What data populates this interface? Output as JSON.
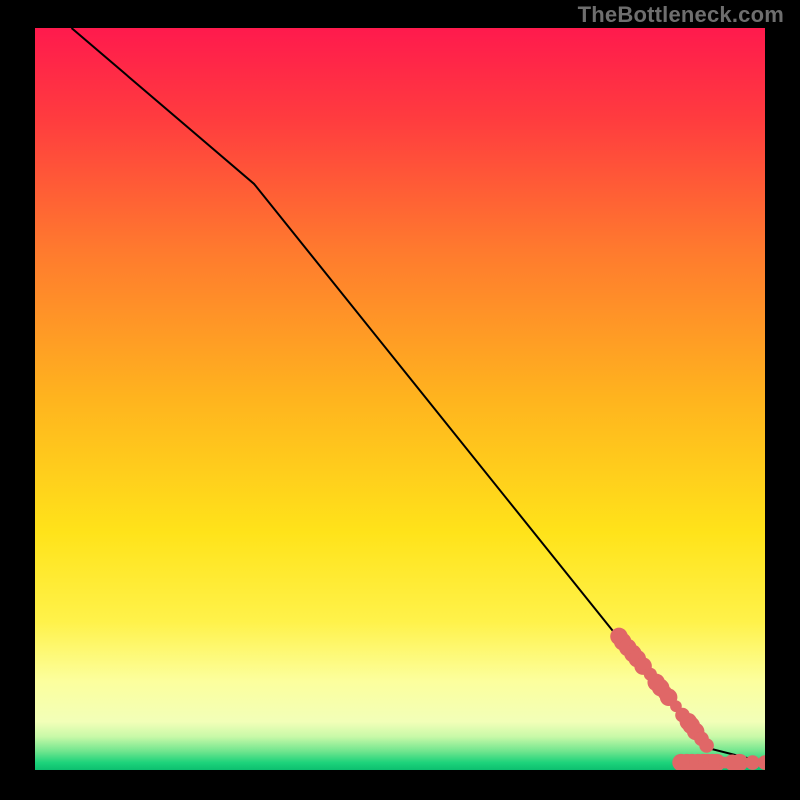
{
  "watermark": "TheBottleneck.com",
  "chart_data": {
    "type": "line",
    "title": "",
    "xlabel": "",
    "ylabel": "",
    "xlim": [
      0,
      100
    ],
    "ylim": [
      0,
      100
    ],
    "line": {
      "x": [
        5,
        30,
        92,
        100
      ],
      "y": [
        100,
        79,
        3,
        1
      ],
      "color": "#000000"
    },
    "scatter": {
      "color": "#e06767",
      "points": [
        {
          "x": 80.0,
          "y": 18.0,
          "r": 1.2
        },
        {
          "x": 80.5,
          "y": 17.3,
          "r": 1.2
        },
        {
          "x": 81.2,
          "y": 16.5,
          "r": 1.2
        },
        {
          "x": 81.9,
          "y": 15.7,
          "r": 1.2
        },
        {
          "x": 82.5,
          "y": 15.0,
          "r": 1.2
        },
        {
          "x": 83.3,
          "y": 14.0,
          "r": 1.2
        },
        {
          "x": 84.3,
          "y": 12.9,
          "r": 0.9
        },
        {
          "x": 85.1,
          "y": 11.8,
          "r": 1.2
        },
        {
          "x": 85.7,
          "y": 11.1,
          "r": 1.2
        },
        {
          "x": 86.3,
          "y": 10.4,
          "r": 1.0
        },
        {
          "x": 86.8,
          "y": 9.8,
          "r": 1.2
        },
        {
          "x": 87.8,
          "y": 8.6,
          "r": 0.8
        },
        {
          "x": 88.7,
          "y": 7.4,
          "r": 1.0
        },
        {
          "x": 89.5,
          "y": 6.5,
          "r": 1.2
        },
        {
          "x": 89.9,
          "y": 6.0,
          "r": 1.2
        },
        {
          "x": 90.5,
          "y": 5.2,
          "r": 1.2
        },
        {
          "x": 91.3,
          "y": 4.2,
          "r": 1.0
        },
        {
          "x": 92.0,
          "y": 3.3,
          "r": 1.0
        },
        {
          "x": 88.5,
          "y": 1.0,
          "r": 1.2
        },
        {
          "x": 89.3,
          "y": 1.0,
          "r": 1.2
        },
        {
          "x": 90.0,
          "y": 1.0,
          "r": 1.2
        },
        {
          "x": 90.8,
          "y": 1.0,
          "r": 1.2
        },
        {
          "x": 91.5,
          "y": 1.0,
          "r": 1.2
        },
        {
          "x": 92.1,
          "y": 1.0,
          "r": 1.2
        },
        {
          "x": 92.8,
          "y": 1.0,
          "r": 1.2
        },
        {
          "x": 93.4,
          "y": 1.0,
          "r": 1.2
        },
        {
          "x": 94.5,
          "y": 1.0,
          "r": 0.8
        },
        {
          "x": 95.5,
          "y": 1.0,
          "r": 1.1
        },
        {
          "x": 96.5,
          "y": 1.0,
          "r": 1.2
        },
        {
          "x": 98.3,
          "y": 1.0,
          "r": 1.0
        },
        {
          "x": 100.0,
          "y": 1.0,
          "r": 1.0
        }
      ]
    },
    "background_gradient": {
      "stops": [
        {
          "offset": 0.0,
          "color": "#ff1a4d"
        },
        {
          "offset": 0.12,
          "color": "#ff3b3f"
        },
        {
          "offset": 0.3,
          "color": "#ff7a2e"
        },
        {
          "offset": 0.5,
          "color": "#ffb41e"
        },
        {
          "offset": 0.68,
          "color": "#ffe31a"
        },
        {
          "offset": 0.8,
          "color": "#fff24a"
        },
        {
          "offset": 0.88,
          "color": "#fcff9d"
        },
        {
          "offset": 0.935,
          "color": "#f2ffb8"
        },
        {
          "offset": 0.955,
          "color": "#c8f9a8"
        },
        {
          "offset": 0.975,
          "color": "#6fe58e"
        },
        {
          "offset": 0.99,
          "color": "#1dd37b"
        },
        {
          "offset": 1.0,
          "color": "#0cbf6f"
        }
      ]
    }
  }
}
